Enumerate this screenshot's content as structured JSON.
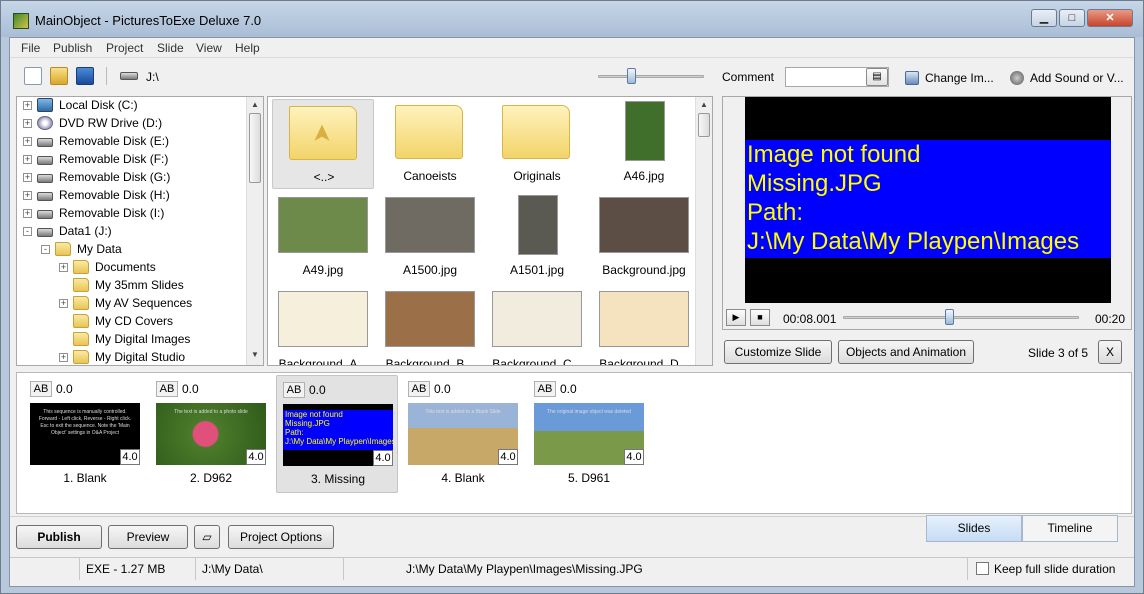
{
  "window": {
    "title": "MainObject - PicturesToExe Deluxe 7.0"
  },
  "menu": [
    "File",
    "Publish",
    "Project",
    "Slide",
    "View",
    "Help"
  ],
  "toolbar": {
    "drive_path": "J:\\",
    "comment_label": "Comment",
    "comment_value": "",
    "change_image_label": "Change Im...",
    "add_sound_label": "Add Sound or V..."
  },
  "tree": [
    {
      "label": "Local Disk (C:)",
      "icon": "local-disk-icon",
      "expander": "+"
    },
    {
      "label": "DVD RW Drive (D:)",
      "icon": "dvd-drive-icon",
      "expander": "+"
    },
    {
      "label": "Removable Disk (E:)",
      "icon": "removable-disk-icon",
      "expander": "+"
    },
    {
      "label": "Removable Disk (F:)",
      "icon": "removable-disk-icon",
      "expander": "+"
    },
    {
      "label": "Removable Disk (G:)",
      "icon": "removable-disk-icon",
      "expander": "+"
    },
    {
      "label": "Removable Disk (H:)",
      "icon": "removable-disk-icon",
      "expander": "+"
    },
    {
      "label": "Removable Disk (I:)",
      "icon": "removable-disk-icon",
      "expander": "+"
    },
    {
      "label": "Data1 (J:)",
      "icon": "drive-icon",
      "expander": "-"
    },
    {
      "label": "My Data",
      "icon": "folder-icon",
      "expander": "-"
    },
    {
      "label": "Documents",
      "icon": "folder-icon",
      "expander": "+"
    },
    {
      "label": "My 35mm Slides",
      "icon": "folder-icon",
      "expander": ""
    },
    {
      "label": "My AV Sequences",
      "icon": "folder-icon",
      "expander": "+"
    },
    {
      "label": "My CD Covers",
      "icon": "folder-icon",
      "expander": ""
    },
    {
      "label": "My Digital Images",
      "icon": "folder-icon",
      "expander": ""
    },
    {
      "label": "My Digital Studio",
      "icon": "folder-icon",
      "expander": "+"
    }
  ],
  "files": [
    {
      "name": "<..>",
      "kind": "up-folder"
    },
    {
      "name": "Canoeists",
      "kind": "folder"
    },
    {
      "name": "Originals",
      "kind": "folder"
    },
    {
      "name": "A46.jpg",
      "kind": "image",
      "color": "#3f6f2a"
    },
    {
      "name": "A49.jpg",
      "kind": "image",
      "color": "#6e8a4a"
    },
    {
      "name": "A1500.jpg",
      "kind": "image",
      "color": "#6f6a62"
    },
    {
      "name": "A1501.jpg",
      "kind": "image",
      "color": "#5a5a52"
    },
    {
      "name": "Background.jpg",
      "kind": "image",
      "color": "#5c4d45"
    },
    {
      "name": "Background_A...",
      "kind": "image",
      "color": "#f5efdc"
    },
    {
      "name": "Background_B...",
      "kind": "image",
      "color": "#9b7048"
    },
    {
      "name": "Background_C...",
      "kind": "image",
      "color": "#f2ecdf"
    },
    {
      "name": "Background_D...",
      "kind": "image",
      "color": "#f5e3bf"
    }
  ],
  "preview": {
    "missing_lines": [
      "Image not found",
      "Missing.JPG",
      "Path:",
      "J:\\My Data\\My Playpen\\Images"
    ],
    "current_time": "00:08.001",
    "total_time": "00:20",
    "progress": 0.45
  },
  "actions": {
    "customize": "Customize Slide",
    "objects": "Objects and Animation",
    "slide_count": "Slide 3 of 5",
    "close": "X"
  },
  "slides": [
    {
      "name": "1. Blank",
      "ab": "AB",
      "transition": "0.0",
      "duration": "4.0",
      "kind": "text",
      "text": "This sequence is manually controlled. Forward - Left click, Reverse - Right click. Esc to exit the sequence. Note the 'Main Object' settings in O&A Project"
    },
    {
      "name": "2. D962",
      "ab": "AB",
      "transition": "0.0",
      "duration": "4.0",
      "kind": "flower",
      "text": "The text is added to a photo slide"
    },
    {
      "name": "3. Missing",
      "ab": "AB",
      "transition": "0.0",
      "duration": "4.0",
      "kind": "missing",
      "text": ""
    },
    {
      "name": "4. Blank",
      "ab": "AB",
      "transition": "0.0",
      "duration": "4.0",
      "kind": "field",
      "text": "This text is added to a Blank Slide"
    },
    {
      "name": "5. D961",
      "ab": "AB",
      "transition": "0.0",
      "duration": "4.0",
      "kind": "trailer",
      "text": "The original image object was deleted"
    }
  ],
  "bottom": {
    "publish": "Publish",
    "preview": "Preview",
    "project_options": "Project Options",
    "tab_slides": "Slides",
    "tab_timeline": "Timeline"
  },
  "status": {
    "exe_size": "EXE - 1.27 MB",
    "folder": "J:\\My Data\\",
    "file_path": "J:\\My Data\\My Playpen\\Images\\Missing.JPG",
    "keep_duration": "Keep full slide duration"
  }
}
